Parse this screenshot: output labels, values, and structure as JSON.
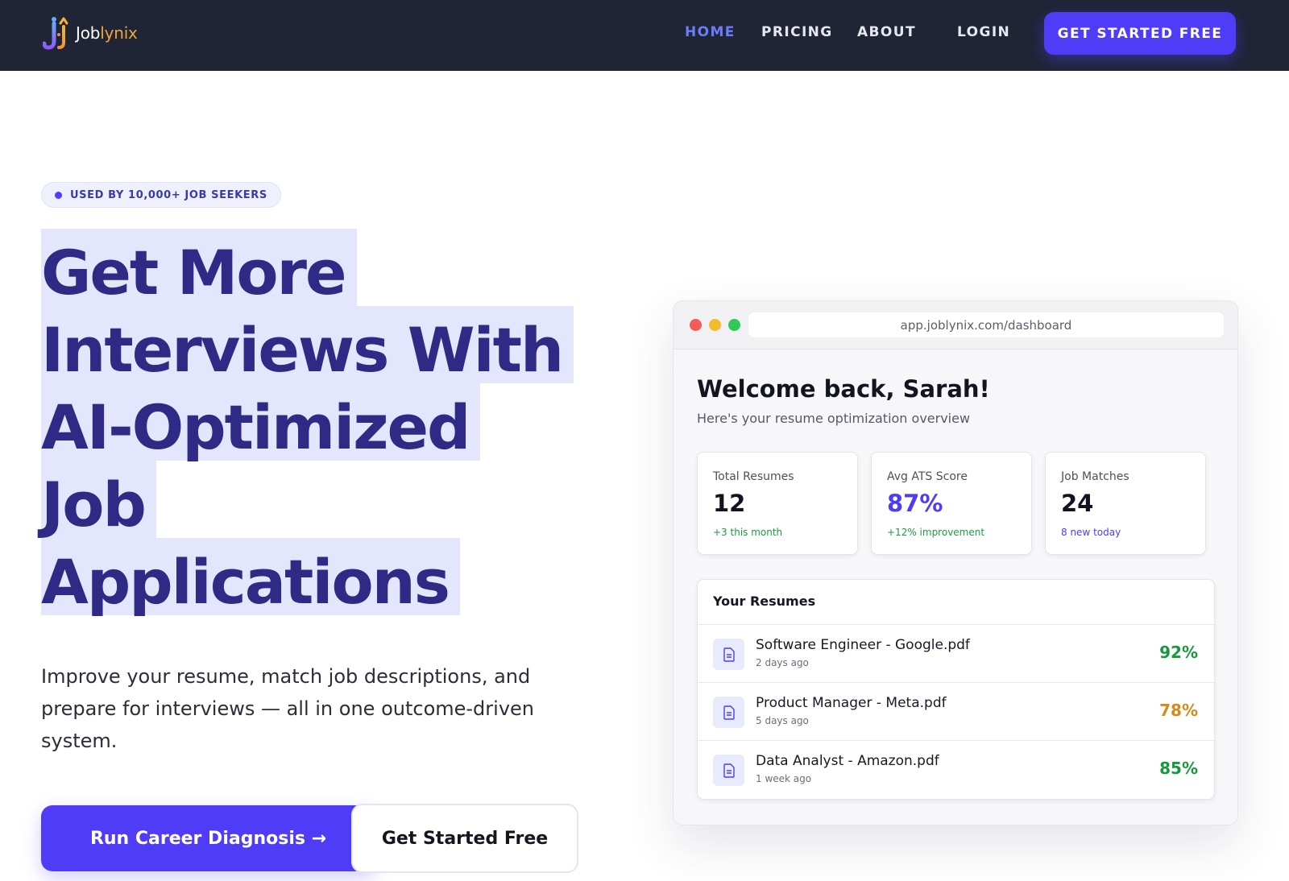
{
  "header": {
    "logo": {
      "text_main": "Job",
      "text_accent": "lynix",
      "icon": "joblynix-logo-icon"
    },
    "nav": [
      {
        "label": "HOME",
        "active": true
      },
      {
        "label": "PRICING",
        "active": false
      },
      {
        "label": "ABOUT",
        "active": false
      },
      {
        "label": "LOGIN",
        "active": false
      }
    ],
    "cta_label": "GET STARTED FREE"
  },
  "hero": {
    "badge": "USED BY 10,000+ JOB SEEKERS",
    "headline_lines": [
      "Get More",
      "Interviews With",
      "AI-Optimized",
      "Job",
      "Applications"
    ],
    "subcopy": "Improve your resume, match job descriptions, and prepare for interviews — all in one outcome-driven system.",
    "primary_button": "Run Career Diagnosis →",
    "secondary_button": "Get Started Free"
  },
  "dashboard": {
    "url": "app.joblynix.com/dashboard",
    "welcome": "Welcome back, Sarah!",
    "subtitle": "Here's your resume optimization overview",
    "stats": [
      {
        "label": "Total Resumes",
        "value": "12",
        "note": "+3 this month",
        "note_color": "green"
      },
      {
        "label": "Avg ATS Score",
        "value": "87%",
        "note": "+12% improvement",
        "note_color": "green"
      },
      {
        "label": "Job Matches",
        "value": "24",
        "note": "8 new today",
        "note_color": "blue"
      }
    ],
    "resumes_title": "Your Resumes",
    "resumes": [
      {
        "name": "Software Engineer - Google.pdf",
        "date": "2 days ago",
        "score": "92%",
        "score_color": "#16993b"
      },
      {
        "name": "Product Manager - Meta.pdf",
        "date": "5 days ago",
        "score": "78%",
        "score_color": "#d4891a"
      },
      {
        "name": "Data Analyst - Amazon.pdf",
        "date": "1 week ago",
        "score": "85%",
        "score_color": "#16993b"
      }
    ]
  },
  "colors": {
    "header_bg": "#1f2535",
    "brand": "#4f3cf6",
    "headline": "#2e2a86",
    "highlight": "#e3e6fd",
    "nav_active": "#6b7cff"
  }
}
